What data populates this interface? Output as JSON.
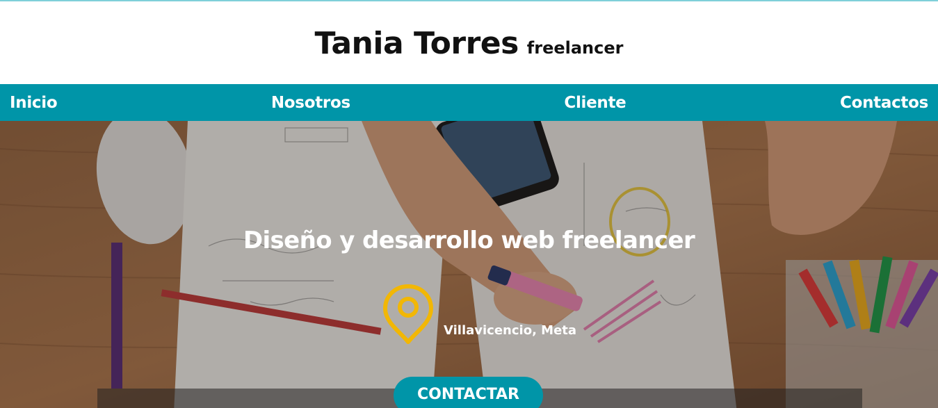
{
  "header": {
    "name": "Tania Torres",
    "tagline": "freelancer"
  },
  "nav": {
    "items": [
      {
        "label": "Inicio"
      },
      {
        "label": "Nosotros"
      },
      {
        "label": "Cliente"
      },
      {
        "label": "Contactos"
      }
    ]
  },
  "hero": {
    "title": "Diseño y desarrollo web freelancer",
    "location_icon": "map-pin-icon",
    "location": "Villavicencio, Meta",
    "cta_label": "CONTACTAR"
  },
  "colors": {
    "accent": "#0095a8",
    "pin": "#f2b705",
    "text_dark": "#111111",
    "text_light": "#ffffff"
  }
}
